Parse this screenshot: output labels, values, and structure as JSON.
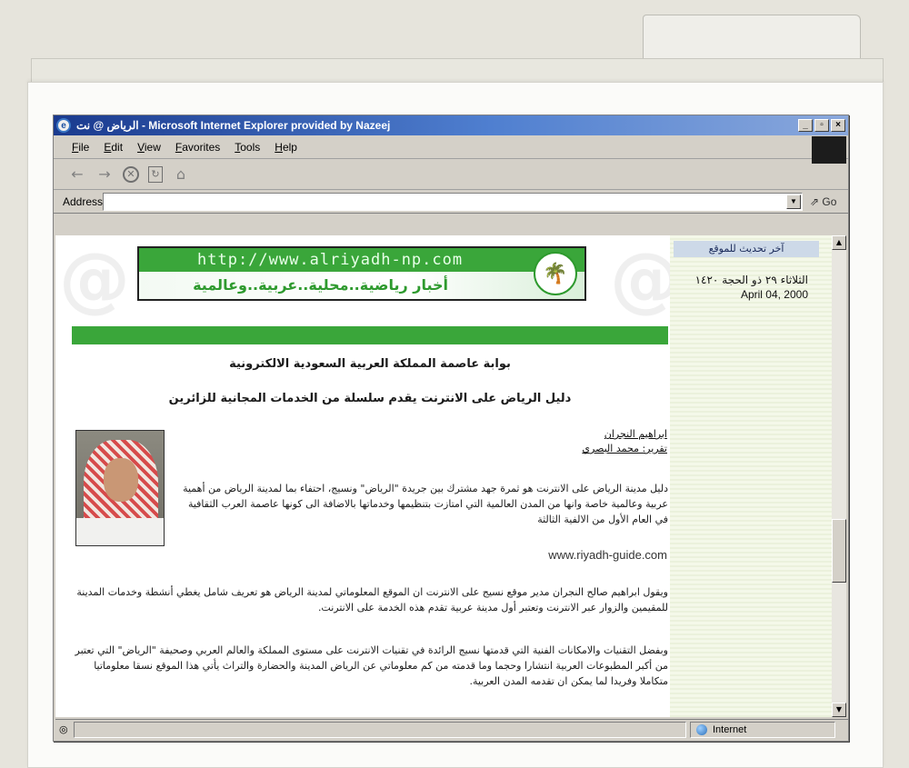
{
  "window": {
    "title": "الرياض @ نت - Microsoft Internet Explorer provided by Nazeej",
    "buttons": {
      "minimize": "_",
      "restore": "▫",
      "close": "×"
    }
  },
  "menu": [
    "File",
    "Edit",
    "View",
    "Favorites",
    "Tools",
    "Help"
  ],
  "toolbar": {
    "back": "←",
    "forward": "→",
    "stop": "✕",
    "refresh": "↻",
    "home": "⌂"
  },
  "address": {
    "label": "Address",
    "value": "",
    "go": "Go",
    "go_arrow": "⇗"
  },
  "page": {
    "banner": {
      "url": "http://www.alriyadh-np.com",
      "tagline": "أخبار رياضية..محلية..عربية..وعالمية"
    },
    "sidebar": {
      "heading": "آخر تحديث للموقع",
      "date_hijri": "الثلاثاء ٢٩ ذو الحجة ١٤٢٠",
      "date_en": "April 04, 2000"
    },
    "headline1": "بوابة عاصمة المملكة العربية السعودية الالكترونية",
    "headline2": "دليل الرياض على الانترنت يقدم سلسلة من الخدمات المجانية للزائرين",
    "byline1": "ابراهيم النجران",
    "byline2": "تقرير: محمد البصري",
    "para1": "دليل مدينة الرياض على الانترنت هو ثمرة جهد مشترك بين جريدة \"الرياض\" ونسيج، احتفاء بما لمدينة الرياض من أهمية عربية وعالمية خاصة وانها من المدن العالمية التي امتازت بتنظيمها وخدماتها بالاضافة الى كونها عاصمة العرب الثقافية في العام الأول من الالفية الثالثة",
    "site_url": "www.riyadh-guide.com",
    "para2": "ويقول ابراهيم صالح النجران مدير موقع نسيج على الانترنت ان الموقع المعلوماتي لمدينة الرياض هو تعريف شامل يغطي أنشطة وخدمات المدينة للمقيمين والزوار عبر الانترنت وتعتبر أول مدينة عربية تقدم هذه الخدمة على الانترنت.",
    "para3": "وبفضل التقنيات والامكانات الفنية التي قدمتها نسيج الرائدة في تقنيات الانترنت على مستوى المملكة والعالم العربي وصحيفة \"الرياض\" التي تعتبر من أكبر المطبوعات العربية انتشارا وحجما وما قدمته من كم معلوماتي عن الرياض المدينة والحضارة والتراث يأتي هذا الموقع نسقا معلوماتيا متكاملا وفريدا لما يمكن ان تقدمه المدن العربية.",
    "para4": ""
  },
  "status": {
    "zone": "Internet"
  },
  "colors": {
    "accent_green": "#3aa63a",
    "title_blue": "#1a3a8e",
    "sidebar_bg": "#f0f5e4"
  }
}
